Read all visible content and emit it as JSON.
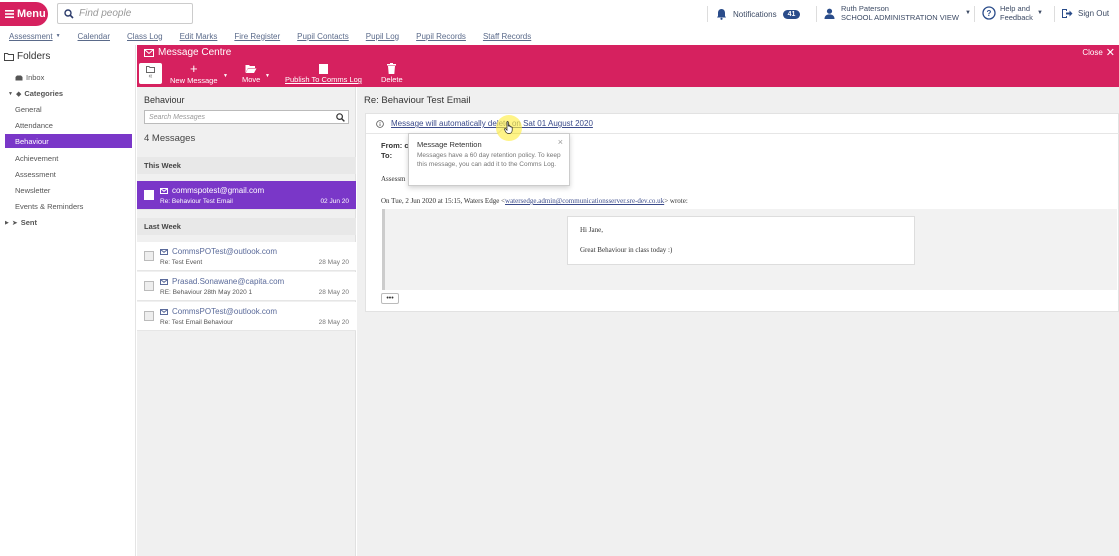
{
  "topbar": {
    "menu_label": "Menu",
    "search_placeholder": "Find people",
    "notifications_label": "Notifications",
    "notifications_count": "41",
    "user_name": "Ruth Paterson",
    "user_view": "SCHOOL ADMINISTRATION VIEW",
    "help_line1": "Help and",
    "help_line2": "Feedback",
    "signout_label": "Sign Out"
  },
  "subnav": {
    "items": [
      "Assessment",
      "Calendar",
      "Class Log",
      "Edit Marks",
      "Fire Register",
      "Pupil Contacts",
      "Pupil Log",
      "Pupil Records",
      "Staff Records"
    ]
  },
  "sidebar": {
    "title": "Folders",
    "inbox": "Inbox",
    "categories": "Categories",
    "category_items": [
      "General",
      "Attendance",
      "Behaviour",
      "Achievement",
      "Assessment",
      "Newsletter",
      "Events & Reminders"
    ],
    "active_index": 2,
    "sent": "Sent"
  },
  "message_centre": {
    "title": "Message Centre",
    "close_label": "Close"
  },
  "toolbar": {
    "collapse_glyph": "«",
    "new_message": "New Message",
    "move": "Move",
    "publish": "Publish To Comms Log",
    "delete": "Delete"
  },
  "list": {
    "folder_title": "Behaviour",
    "search_placeholder": "Search Messages",
    "count": "4 Messages",
    "this_week_label": "This Week",
    "last_week_label": "Last Week",
    "this_week": [
      {
        "from": "commspotest@gmail.com",
        "subject": "Re: Behaviour Test Email",
        "date": "02 Jun 20"
      }
    ],
    "last_week": [
      {
        "from": "CommsPOTest@outlook.com",
        "subject": "Re: Test Event",
        "date": "28 May 20"
      },
      {
        "from": "Prasad.Sonawane@capita.com",
        "subject": "RE: Behaviour 28th May 2020 1",
        "date": "28 May 20"
      },
      {
        "from": "CommsPOTest@outlook.com",
        "subject": "Re: Test Email Behaviour",
        "date": "28 May 20"
      }
    ]
  },
  "reading": {
    "title": "Re: Behaviour Test Email",
    "retention_notice": "Message will automatically delete on Sat 01 August 2020",
    "from_label": "From: co",
    "to_label": "To:",
    "assess_fragment": "Assessm",
    "wrote_prefix": "On Tue, 2 Jun 2020 at 15:15, Waters Edge <",
    "wrote_link": "watersedge.admin@communicationsserver.sre-dev.co.uk",
    "wrote_suffix": "> wrote:",
    "quote_greeting": "Hi Jane,",
    "quote_body": "Great Behaviour in class today :)",
    "ellipsis": "•••"
  },
  "popover": {
    "title": "Message Retention",
    "close_glyph": "×",
    "body": "Messages have a 60 day retention policy. To keep this message, you can add it to the Comms Log."
  },
  "colors": {
    "brand": "#d6215f",
    "selected": "#7a37c8",
    "link": "#3a4a8a"
  }
}
